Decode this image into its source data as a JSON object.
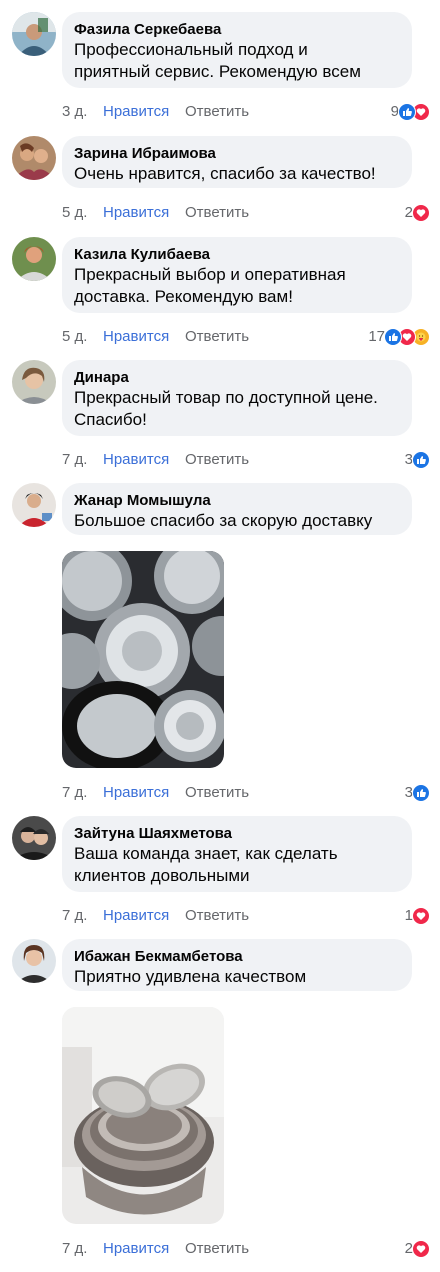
{
  "actions": {
    "like_label": "Нравится",
    "reply_label": "Ответить"
  },
  "colors": {
    "bubble": "#f0f2f5",
    "like_text": "#3b6fd8",
    "meta": "#65676b",
    "like_icon": "#1b74e4",
    "love_icon": "#f0284a",
    "care_icon": "#f7b125"
  },
  "comments": [
    {
      "author": "Фазила Серкебаева",
      "text": "Профессиональный подход и\nприятный сервис. Рекомендую всем",
      "time": "3 д.",
      "count": "9",
      "reactions": [
        "like-icon",
        "love-icon"
      ]
    },
    {
      "author": "Зарина Ибраимова",
      "text": "Очень нравится, спасибо за качество!",
      "time": "5 д.",
      "count": "2",
      "reactions": [
        "love-icon"
      ]
    },
    {
      "author": "Казила Кулибаева",
      "text": "Прекрасный выбор и оперативная\nдоставка. Рекомендую вам!",
      "time": "5 д.",
      "count": "17",
      "reactions": [
        "like-icon",
        "love-icon",
        "care-icon"
      ]
    },
    {
      "author": "Динара",
      "text": "Прекрасный товар по доступной цене.\nСпасибо!",
      "time": "7 д.",
      "count": "3",
      "reactions": [
        "like-icon"
      ]
    },
    {
      "author": "Жанар Момышула",
      "text": "Большое спасибо за скорую доставку",
      "time": "7 д.",
      "count": "3",
      "reactions": [
        "like-icon"
      ],
      "photo": "stainless-bowls-photo"
    },
    {
      "author": "Зайтуна Шаяхметова",
      "text": "Ваша команда знает, как сделать\nклиентов довольными",
      "time": "7 д.",
      "count": "1",
      "reactions": [
        "love-icon"
      ]
    },
    {
      "author": "Ибажан Бекмамбетова",
      "text": "Приятно удивлена качеством",
      "time": "7 д.",
      "count": "2",
      "reactions": [
        "love-icon"
      ],
      "photo": "bowls-with-graters-photo"
    }
  ]
}
